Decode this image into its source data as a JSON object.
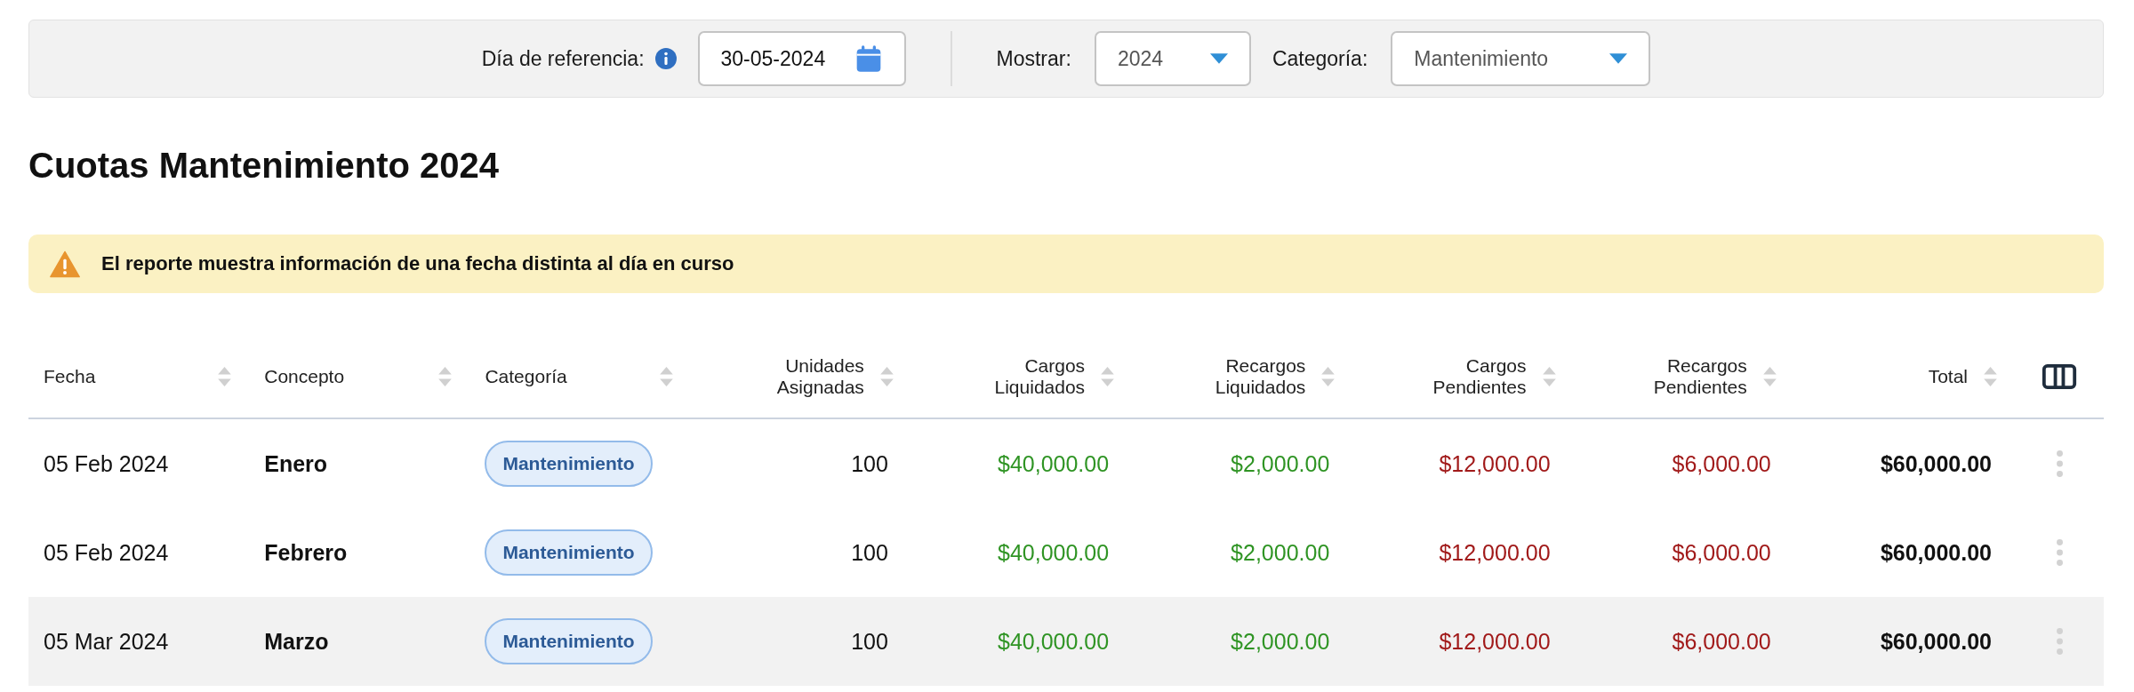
{
  "filters": {
    "reference_day": {
      "label": "Día de referencia:",
      "value": "30-05-2024"
    },
    "show": {
      "label": "Mostrar:",
      "value": "2024"
    },
    "category": {
      "label": "Categoría:",
      "value": "Mantenimiento"
    }
  },
  "title": "Cuotas Mantenimiento 2024",
  "alert": {
    "text": "El reporte muestra información de una fecha distinta al día en curso"
  },
  "table": {
    "columns": [
      {
        "label": "Fecha",
        "kind": "date"
      },
      {
        "label": "Concepto",
        "kind": "concept"
      },
      {
        "label": "Categoría",
        "kind": "badge"
      },
      {
        "label": "Unidades Asignadas",
        "kind": "number"
      },
      {
        "label": "Cargos Liquidados",
        "kind": "paid"
      },
      {
        "label": "Recargos Liquidados",
        "kind": "paid"
      },
      {
        "label": "Cargos Pendientes",
        "kind": "pending"
      },
      {
        "label": "Recargos Pendientes",
        "kind": "pending"
      },
      {
        "label": "Total",
        "kind": "total"
      }
    ],
    "rows": [
      {
        "highlighted": false,
        "cells": [
          "05 Feb 2024",
          "Enero",
          "Mantenimiento",
          "100",
          "$40,000.00",
          "$2,000.00",
          "$12,000.00",
          "$6,000.00",
          "$60,000.00"
        ]
      },
      {
        "highlighted": false,
        "cells": [
          "05 Feb 2024",
          "Febrero",
          "Mantenimiento",
          "100",
          "$40,000.00",
          "$2,000.00",
          "$12,000.00",
          "$6,000.00",
          "$60,000.00"
        ]
      },
      {
        "highlighted": true,
        "cells": [
          "05 Mar 2024",
          "Marzo",
          "Mantenimiento",
          "100",
          "$40,000.00",
          "$2,000.00",
          "$12,000.00",
          "$6,000.00",
          "$60,000.00"
        ]
      }
    ]
  }
}
